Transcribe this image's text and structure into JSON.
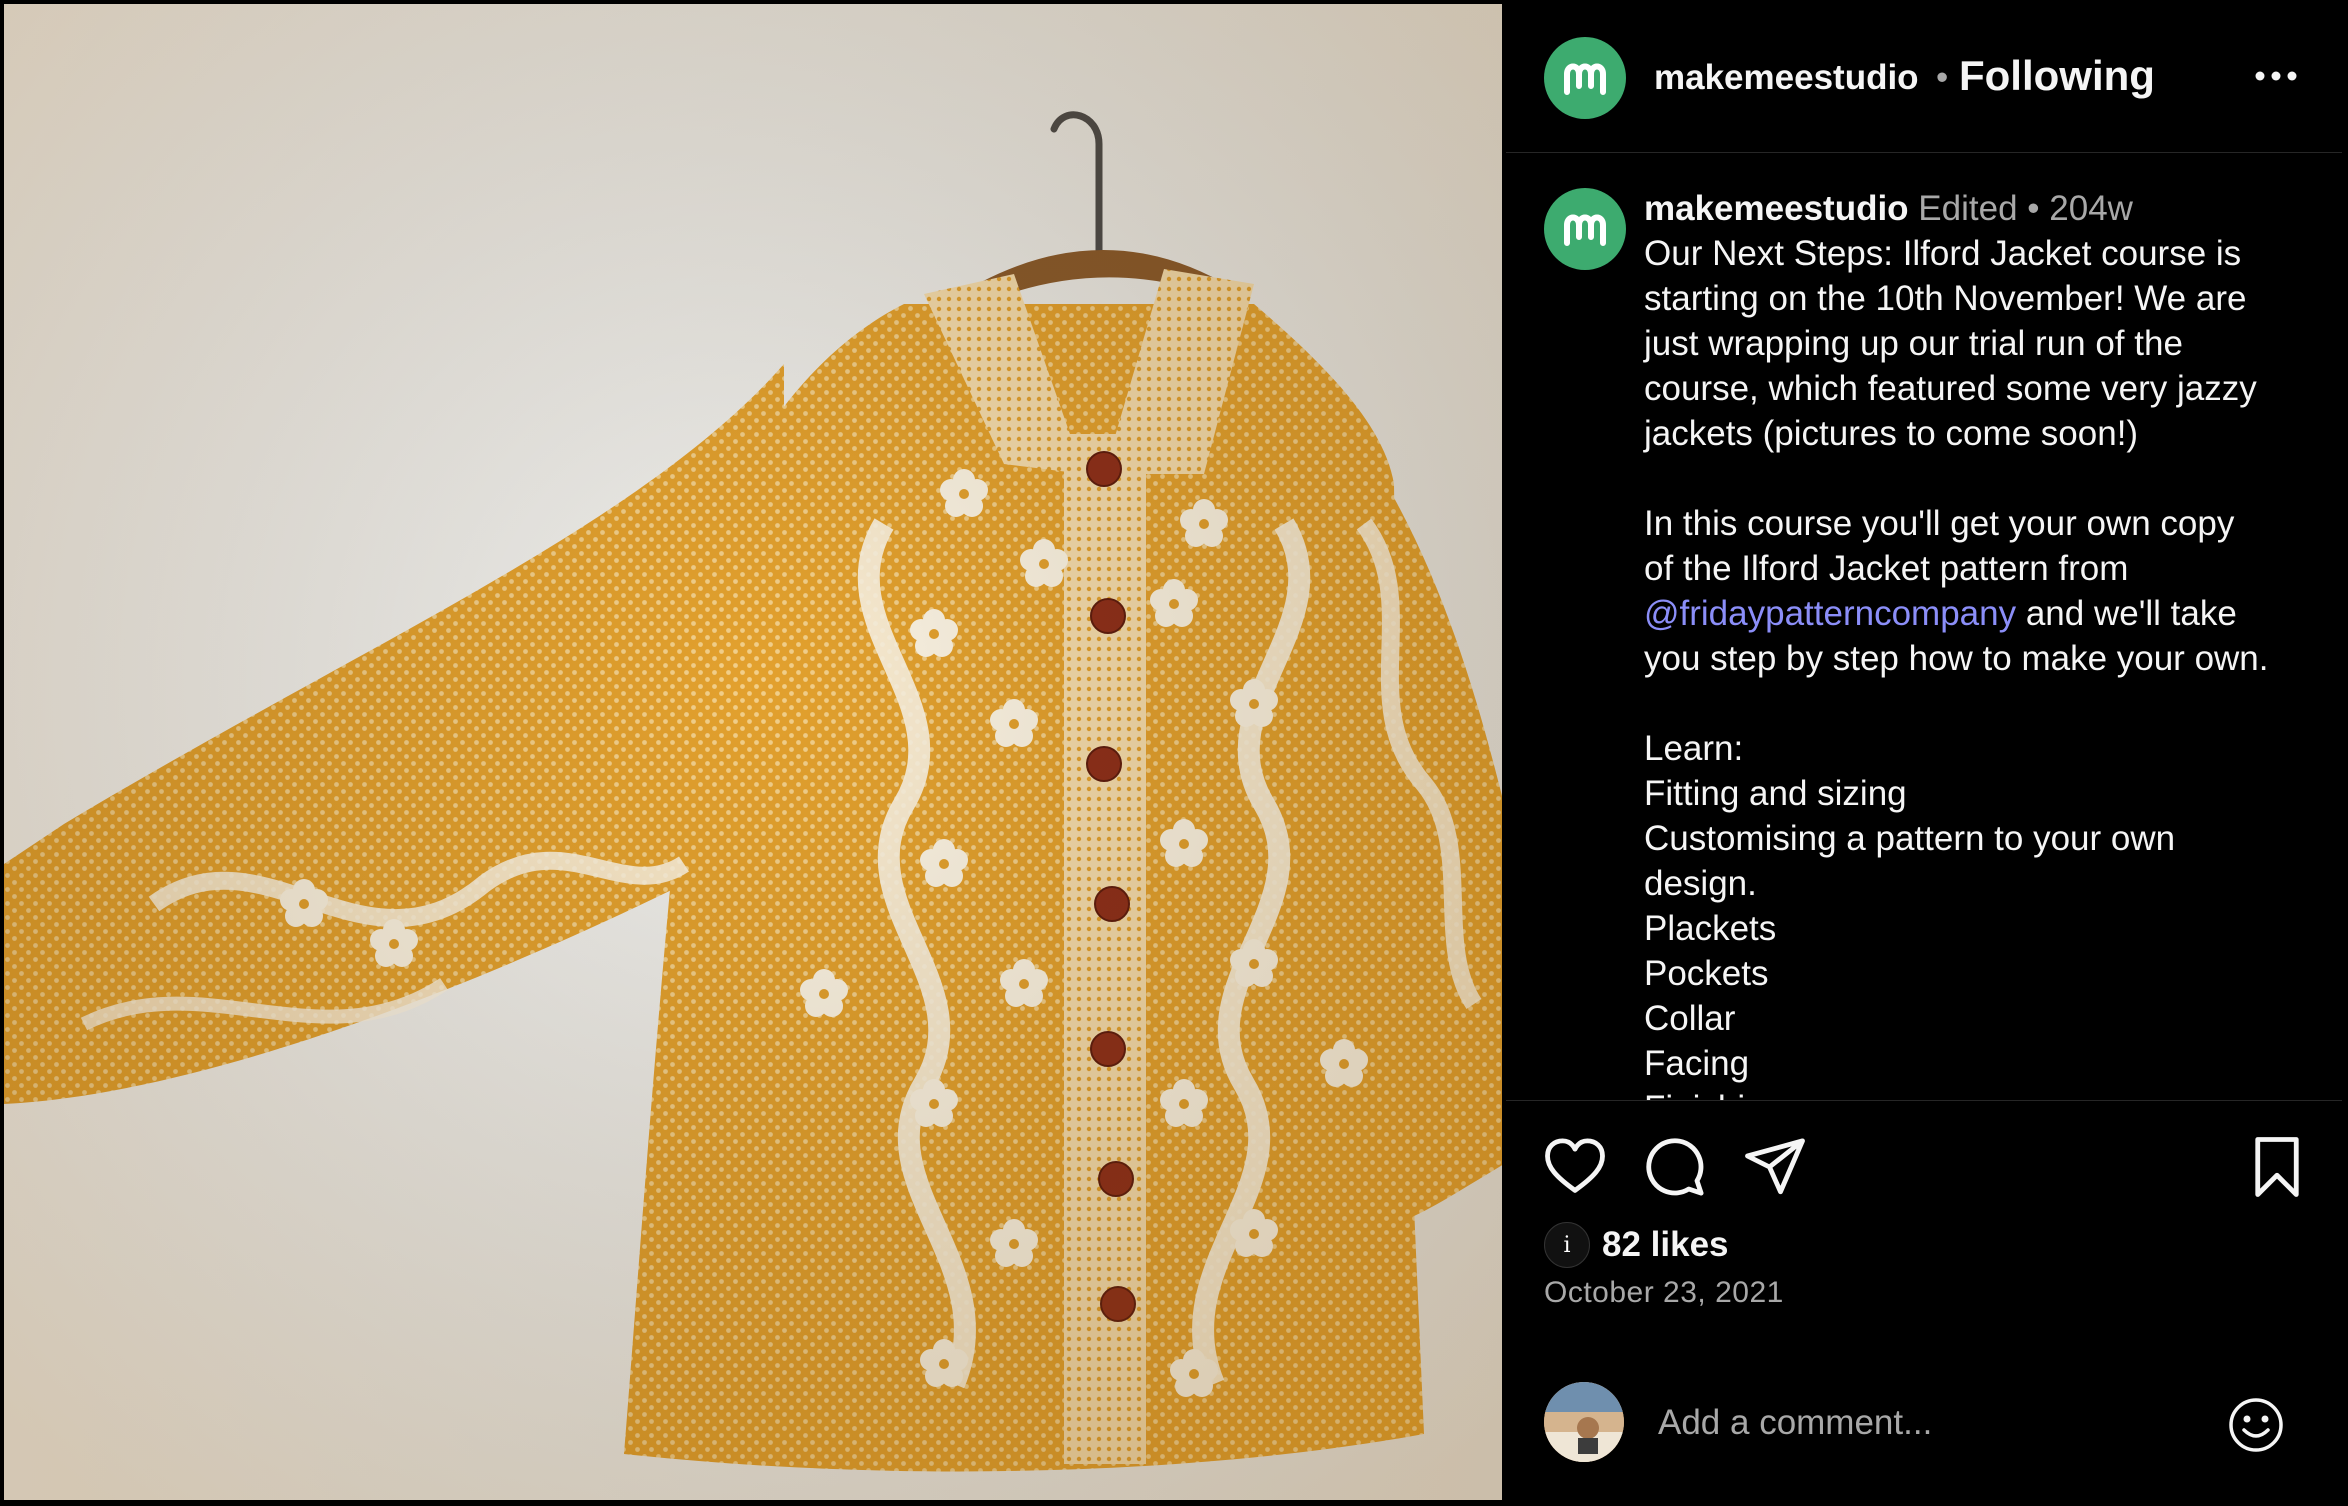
{
  "post": {
    "username": "makemeestudio",
    "separator": "•",
    "follow_status": "Following",
    "more_icon": "more-horizontal-icon"
  },
  "caption": {
    "username": "makemeestudio",
    "edited": "Edited",
    "dot": "•",
    "age": "204w",
    "lines": [
      "Our Next Steps: Ilford Jacket course is",
      "starting on the 10th November! We are",
      "just wrapping up our trial run of the",
      "course, which featured some very jazzy",
      "jackets (pictures to come soon!)",
      "",
      "In this course you'll get your own copy",
      "of the Ilford Jacket pattern from"
    ],
    "mention": "@fridaypatterncompany",
    "mention_suffix": " and we'll take",
    "lines_after": [
      "you step by step how to make your own.",
      "",
      "Learn:",
      "Fitting and sizing",
      "Customising a pattern to your own",
      "design.",
      "Plackets",
      "Pockets",
      "Collar",
      "Facing",
      "Finishing seams"
    ]
  },
  "actions": {
    "like_icon": "heart-icon",
    "comment_icon": "comment-bubble-icon",
    "share_icon": "paper-plane-icon",
    "save_icon": "bookmark-icon"
  },
  "likes": {
    "liker_avatar_letter": "i",
    "text": "82 likes"
  },
  "date": "October 23, 2021",
  "comment": {
    "placeholder": "Add a comment...",
    "emoji_icon": "smiley-icon"
  },
  "colors": {
    "background": "#000000",
    "avatar_green": "#3dab6f",
    "mention_blue": "#8b8ef8",
    "secondary_text": "#a8a8a8",
    "jacket_mustard": "#e3a12e"
  }
}
